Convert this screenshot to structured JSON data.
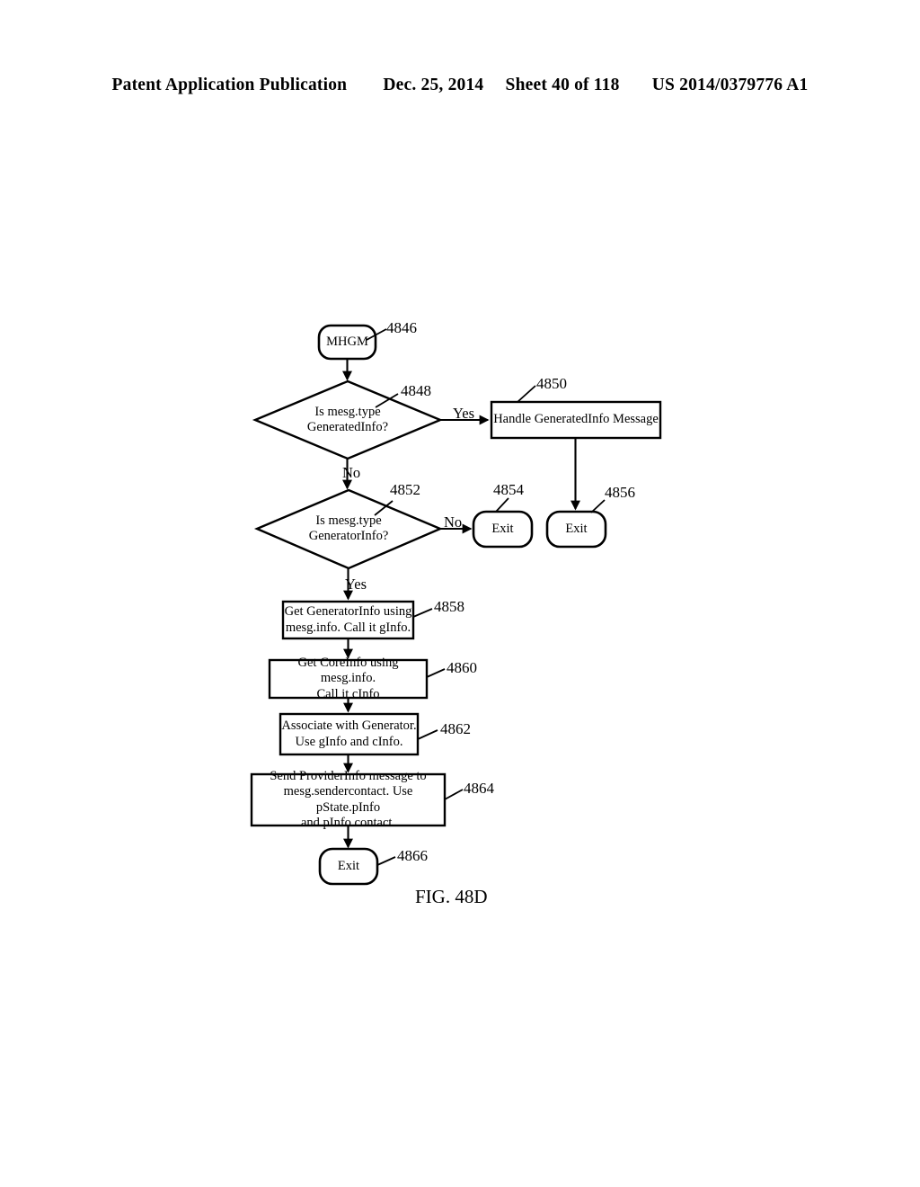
{
  "header": {
    "publication": "Patent Application Publication",
    "date": "Dec. 25, 2014",
    "sheet": "Sheet 40 of 118",
    "patent_number": "US 2014/0379776 A1"
  },
  "figure": {
    "caption": "FIG. 48D",
    "nodes": [
      {
        "id": "4846",
        "type": "terminal",
        "label": "MHGM"
      },
      {
        "id": "4848",
        "type": "decision",
        "label": "Is mesg.type\nGeneratedInfo?"
      },
      {
        "id": "4850",
        "type": "process",
        "label": "Handle GeneratedInfo Message"
      },
      {
        "id": "4852",
        "type": "decision",
        "label": "Is mesg.type\nGeneratorInfo?"
      },
      {
        "id": "4854",
        "type": "terminal",
        "label": "Exit"
      },
      {
        "id": "4856",
        "type": "terminal",
        "label": "Exit"
      },
      {
        "id": "4858",
        "type": "process",
        "label": "Get GeneratorInfo using\nmesg.info. Call it gInfo."
      },
      {
        "id": "4860",
        "type": "process",
        "label": "Get CoreInfo using mesg.info.\nCall it cInfo"
      },
      {
        "id": "4862",
        "type": "process",
        "label": "Associate with Generator.\nUse gInfo and cInfo."
      },
      {
        "id": "4864",
        "type": "process",
        "label": "Send ProviderInfo message to\nmesg.sendercontact. Use pState.pInfo\nand pInfo.contact."
      },
      {
        "id": "4866",
        "type": "terminal",
        "label": "Exit"
      }
    ],
    "edge_labels": {
      "yes_4848": "Yes",
      "no_4848": "No",
      "no_4852": "No",
      "yes_4852": "Yes"
    },
    "reference_numerals": [
      "4846",
      "4848",
      "4850",
      "4852",
      "4854",
      "4856",
      "4858",
      "4860",
      "4862",
      "4864",
      "4866"
    ],
    "colors": {
      "stroke": "#000000",
      "background": "#ffffff"
    }
  }
}
